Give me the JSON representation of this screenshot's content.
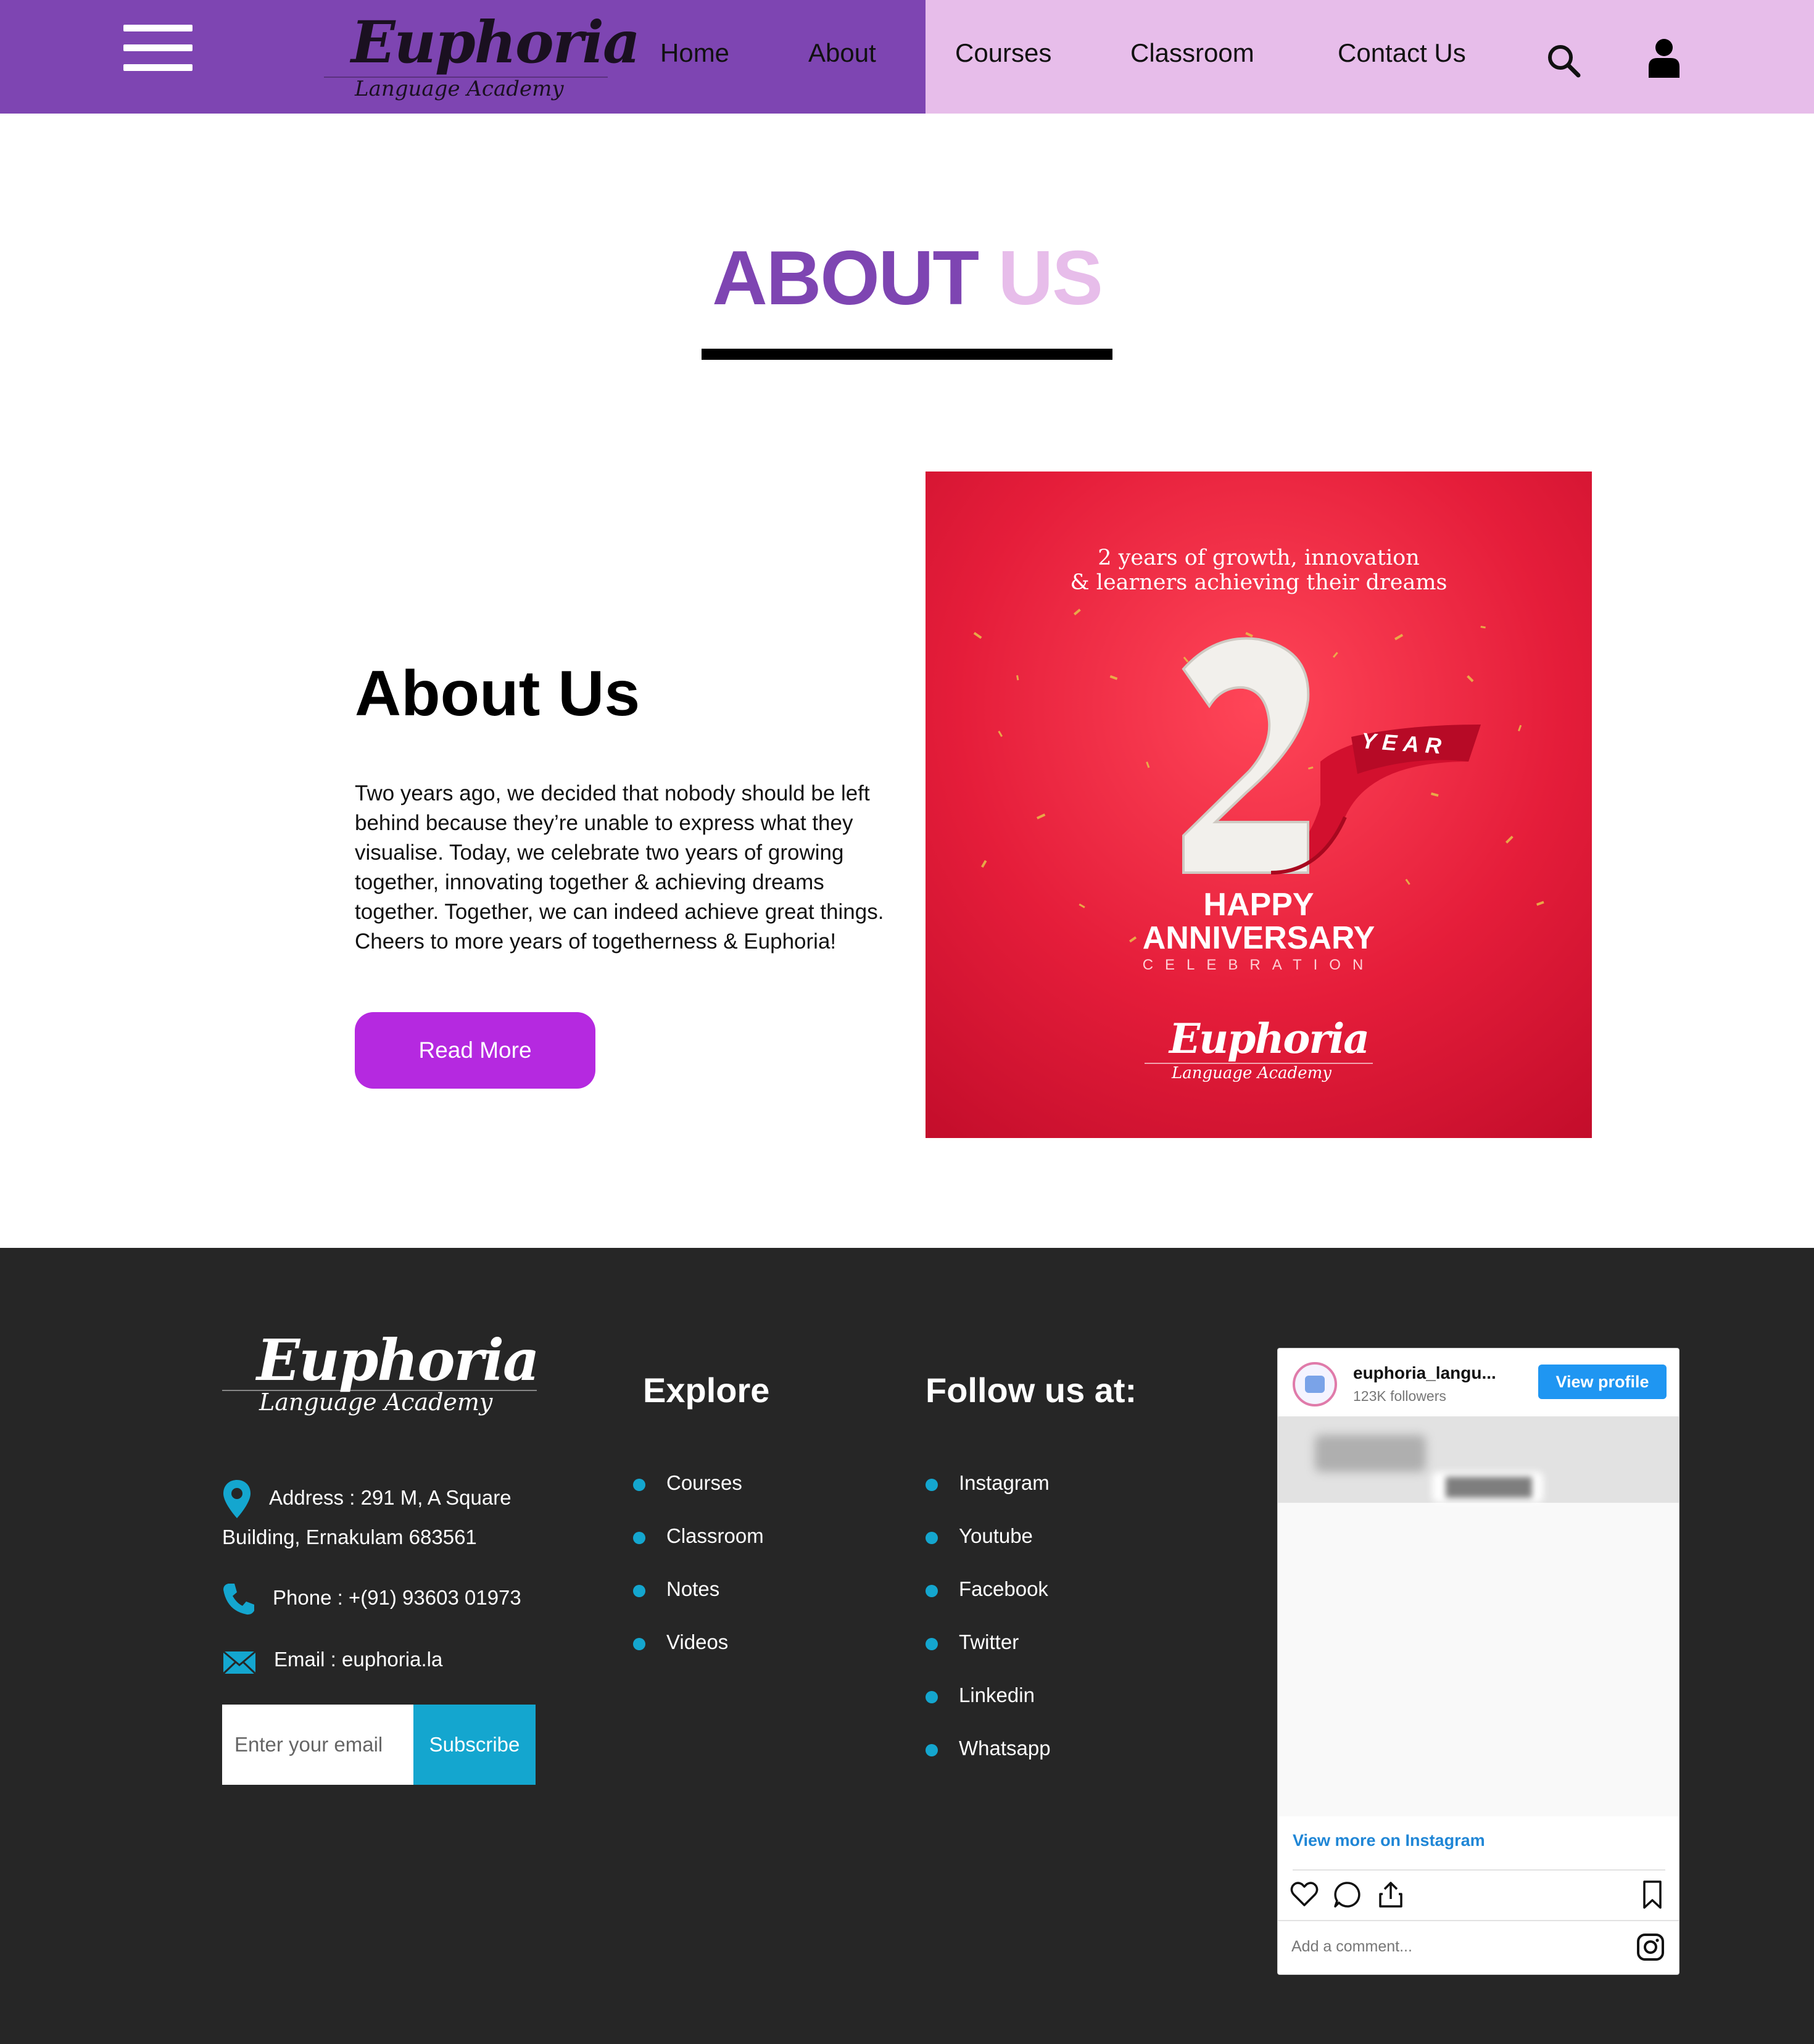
{
  "header": {
    "logo": {
      "script": "Euphoria",
      "subtitle": "Language Academy"
    },
    "nav": [
      "Home",
      "About",
      "Courses",
      "Classroom",
      "Contact Us"
    ],
    "colors": {
      "left_bg": "#7e45b2",
      "right_bg": "#e7bdea"
    },
    "icons": [
      "menu-icon",
      "search-icon",
      "user-icon"
    ]
  },
  "hero": {
    "title_word1": "ABOUT",
    "title_word2": "US"
  },
  "about": {
    "heading": "About Us",
    "body": "Two years ago, we decided that nobody should be left behind because they’re unable to express what they visualise. Today, we celebrate two years of growing together, innovating together & achieving dreams together. Together, we can indeed achieve great things. Cheers to more years of togetherness & Euphoria!",
    "button": "Read More",
    "button_color": "#b529e0"
  },
  "promo": {
    "tagline_line1": "2 years of growth, innovation",
    "tagline_line2": "& learners achieving their dreams",
    "number": "2",
    "year_label": "YEAR",
    "happy": "HAPPY",
    "anniversary": "ANNIVERSARY",
    "celebration": "CELEBRATION",
    "logo_script": "Euphoria",
    "logo_subtitle": "Language Academy"
  },
  "footer": {
    "logo": {
      "script": "Euphoria",
      "subtitle": "Language Academy"
    },
    "address_line1": "Address : 291 M, A Square",
    "address_line2": "Building, Ernakulam 683561",
    "phone": "Phone : +(91) 93603 01973",
    "email": "Email : euphoria.la",
    "subscribe": {
      "placeholder": "Enter your email",
      "button": "Subscribe"
    },
    "explore": {
      "title": "Explore",
      "links": [
        "Courses",
        "Classroom",
        "Notes",
        "Videos"
      ]
    },
    "follow": {
      "title": "Follow us at:",
      "links": [
        "Instagram",
        "Youtube",
        "Facebook",
        "Twitter",
        "Linkedin",
        "Whatsapp"
      ]
    },
    "accent": "#14a6cf",
    "bg": "#262626"
  },
  "instagram": {
    "username": "euphoria_langu...",
    "followers": "123K followers",
    "view_profile": "View profile",
    "view_more": "View more on Instagram",
    "comment_placeholder": "Add a comment...",
    "icons": [
      "heart-icon",
      "comment-icon",
      "share-icon",
      "bookmark-icon",
      "instagram-icon"
    ]
  }
}
